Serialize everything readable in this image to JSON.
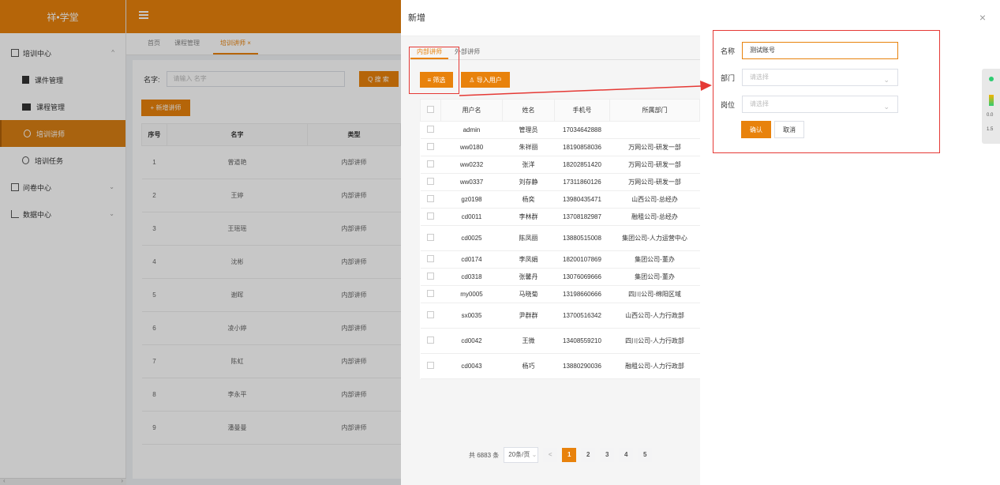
{
  "app": {
    "brand": "祥•学堂"
  },
  "sidebar": {
    "items": [
      {
        "label": "培训中心",
        "type": "group",
        "chevron": "^"
      },
      {
        "label": "课件管理",
        "type": "sub"
      },
      {
        "label": "课程管理",
        "type": "sub"
      },
      {
        "label": "培训讲师",
        "type": "sub",
        "active": true
      },
      {
        "label": "培训任务",
        "type": "sub"
      },
      {
        "label": "问卷中心",
        "type": "group",
        "chevron": "⌄"
      },
      {
        "label": "数据中心",
        "type": "group",
        "chevron": "⌄"
      }
    ],
    "scroll_left": "‹",
    "scroll_right": "›"
  },
  "tabs": [
    {
      "label": "首页"
    },
    {
      "label": "课程管理"
    },
    {
      "label": "培训讲师 ×",
      "active": true
    }
  ],
  "search": {
    "label": "名字:",
    "placeholder": "请输入 名字",
    "button": "Q 搜 索"
  },
  "add_button": "+ 新增讲师",
  "lecturer_table": {
    "headers": [
      "序号",
      "名字",
      "类型"
    ],
    "rows": [
      [
        "1",
        "曾道艳",
        "内部讲师"
      ],
      [
        "2",
        "王婷",
        "内部讲师"
      ],
      [
        "3",
        "王瑶瑶",
        "内部讲师"
      ],
      [
        "4",
        "沈彬",
        "内部讲师"
      ],
      [
        "5",
        "谢晖",
        "内部讲师"
      ],
      [
        "6",
        "凌小婷",
        "内部讲师"
      ],
      [
        "7",
        "陈虹",
        "内部讲师"
      ],
      [
        "8",
        "李永平",
        "内部讲师"
      ],
      [
        "9",
        "潘曼曼",
        "内部讲师"
      ]
    ]
  },
  "drawer": {
    "title": "新增",
    "tabs": [
      "内部讲师",
      "外部讲师"
    ],
    "filter_button": "≡ 筛选",
    "import_button": "♙ 导入用户",
    "table": {
      "headers": [
        "",
        "用户名",
        "姓名",
        "手机号",
        "所属部门"
      ],
      "rows": [
        [
          "admin",
          "管理员",
          "17034642888",
          ""
        ],
        [
          "ww0180",
          "朱祥丽",
          "18190858036",
          "万网公司-研发一部"
        ],
        [
          "ww0232",
          "张洋",
          "18202851420",
          "万网公司-研发一部"
        ],
        [
          "ww0337",
          "刘存静",
          "17311860126",
          "万网公司-研发一部"
        ],
        [
          "gz0198",
          "杨奕",
          "13980435471",
          "山西公司-总经办"
        ],
        [
          "cd0011",
          "李林群",
          "13708182987",
          "融租公司-总经办"
        ],
        [
          "cd0025",
          "陈凤丽",
          "13880515008",
          "集团公司-人力运营中心"
        ],
        [
          "cd0174",
          "李凤娟",
          "18200107869",
          "集团公司-董办"
        ],
        [
          "cd0318",
          "张馨丹",
          "13076069666",
          "集团公司-董办"
        ],
        [
          "my0005",
          "马晓菊",
          "13198660666",
          "四川公司-绵阳区域"
        ],
        [
          "sx0035",
          "尹群群",
          "13700516342",
          "山西公司-人力行政部"
        ],
        [
          "cd0042",
          "王微",
          "13408559210",
          "四川公司-人力行政部"
        ],
        [
          "cd0043",
          "杨巧",
          "13880290036",
          "融租公司-人力行政部"
        ]
      ]
    },
    "pager": {
      "total": "共 6883 条",
      "page_size": "20条/页",
      "prev": "<",
      "pages": [
        "1",
        "2",
        "3",
        "4",
        "5"
      ]
    }
  },
  "form": {
    "name_label": "名称",
    "name_value": "测试账号",
    "dept_label": "部门",
    "dept_placeholder": "请选择",
    "post_label": "岗位",
    "post_placeholder": "请选择",
    "confirm": "确认",
    "cancel": "取消"
  },
  "close_icon": "×",
  "widget": {
    "val1": "0.0",
    "val2": "1.5"
  },
  "colors": {
    "accent": "#e8820c",
    "highlight": "#e53935"
  }
}
